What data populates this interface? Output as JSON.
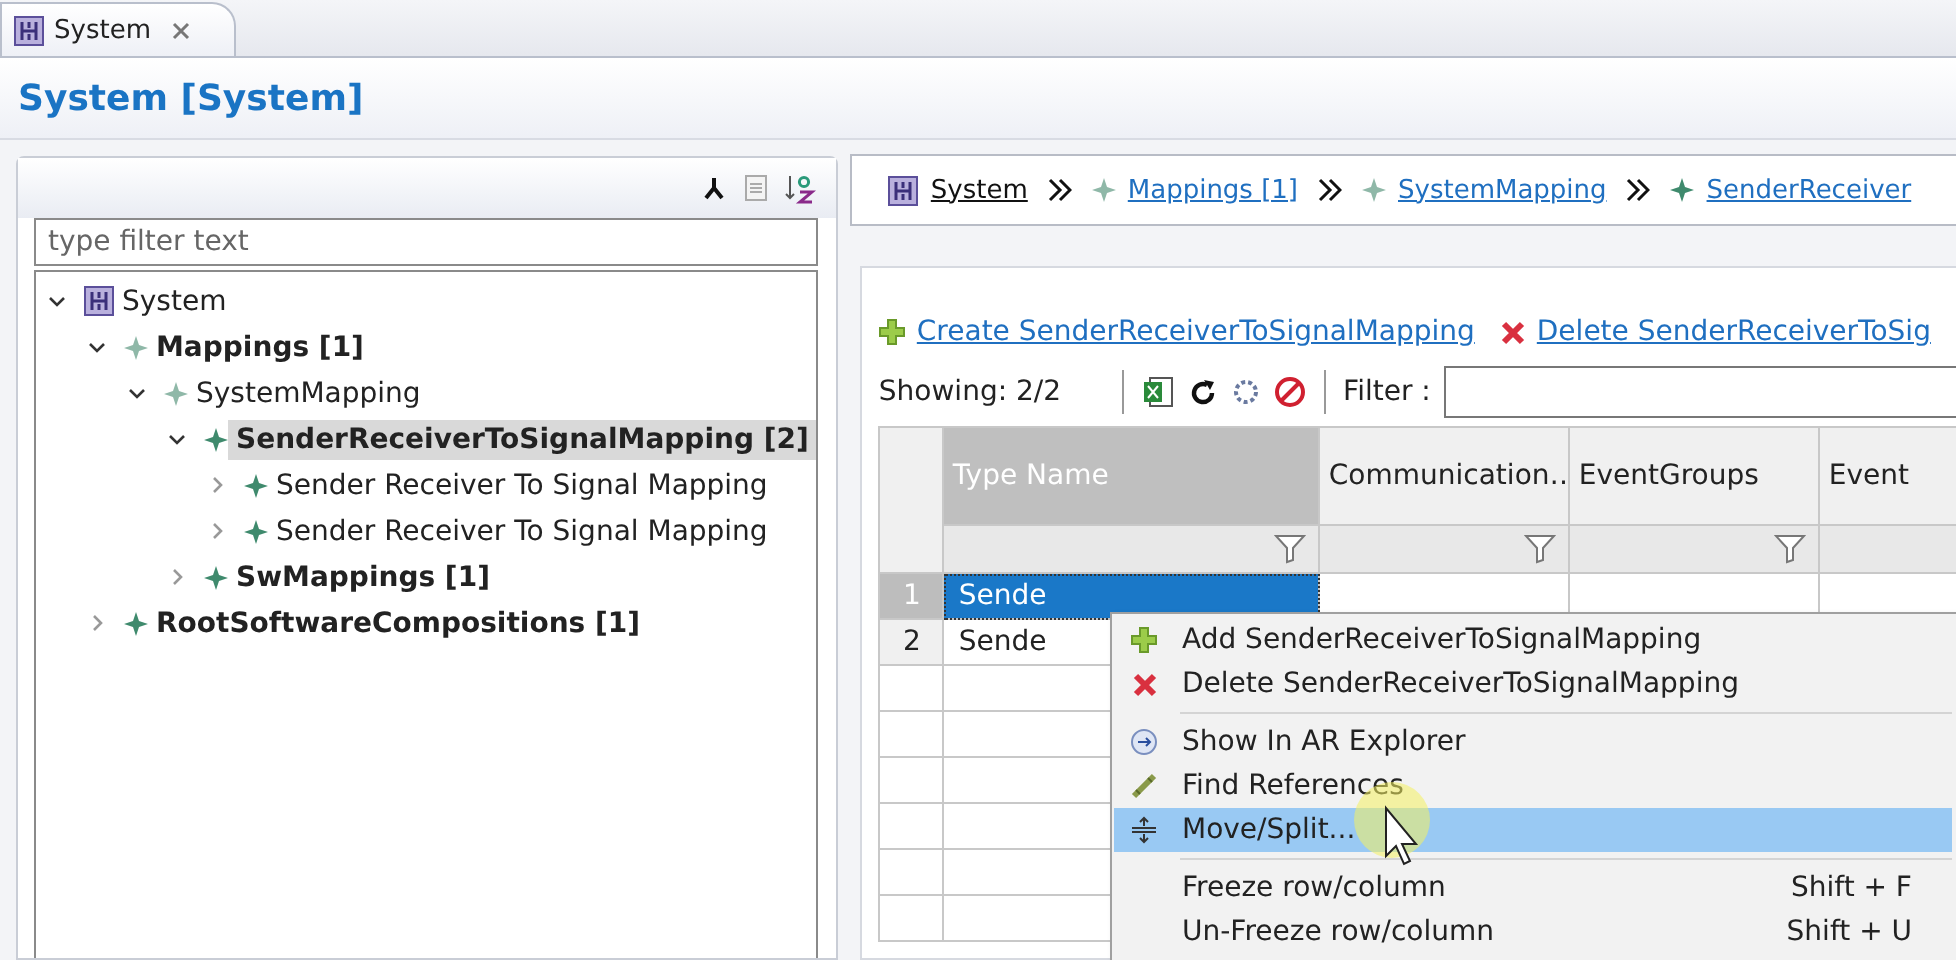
{
  "editor_tab": {
    "label": "System"
  },
  "page_title": "System [System]",
  "outline": {
    "filter": {
      "placeholder": "type filter text"
    },
    "tree": [
      {
        "label": "System",
        "kind": "system",
        "bold": false,
        "selected": false,
        "expanded": true,
        "children": [
          {
            "label": "Mappings [1]",
            "kind": "element",
            "bold": true,
            "selected": false,
            "expanded": true,
            "children": [
              {
                "label": "SystemMapping",
                "kind": "element",
                "bold": false,
                "selected": false,
                "expanded": true,
                "children": [
                  {
                    "label": "SenderReceiverToSignalMapping [2]",
                    "kind": "mapping",
                    "bold": true,
                    "selected": true,
                    "expanded": true,
                    "children": [
                      {
                        "label": "Sender Receiver To Signal Mapping",
                        "kind": "mapping",
                        "bold": false,
                        "selected": false,
                        "expanded": false
                      },
                      {
                        "label": "Sender Receiver To Signal Mapping",
                        "kind": "mapping",
                        "bold": false,
                        "selected": false,
                        "expanded": false
                      }
                    ]
                  },
                  {
                    "label": "SwMappings [1]",
                    "kind": "mapping",
                    "bold": true,
                    "selected": false,
                    "expanded": false
                  }
                ]
              }
            ]
          },
          {
            "label": "RootSoftwareCompositions [1]",
            "kind": "mapping",
            "bold": true,
            "selected": false,
            "expanded": false
          }
        ]
      }
    ]
  },
  "breadcrumb": [
    {
      "label": "System",
      "kind": "system"
    },
    {
      "label": "Mappings [1]",
      "kind": "element"
    },
    {
      "label": "SystemMapping",
      "kind": "element"
    },
    {
      "label": "SenderReceiver",
      "kind": "mapping"
    }
  ],
  "actions": [
    {
      "label": "Create SenderReceiverToSignalMapping",
      "kind": "create"
    },
    {
      "label": "Delete SenderReceiverToSig",
      "kind": "delete"
    }
  ],
  "table_toolbar": {
    "showing": "Showing: 2/2",
    "filter_label": "Filter :"
  },
  "table": {
    "columns": [
      {
        "label": "Type Name",
        "selected": true
      },
      {
        "label": "Communication…",
        "selected": false
      },
      {
        "label": "EventGroups",
        "selected": false
      },
      {
        "label": "Event",
        "selected": false
      }
    ],
    "rows": [
      {
        "number": "1",
        "cells": [
          "Sende"
        ],
        "selected": true
      },
      {
        "number": "2",
        "cells": [
          "Sende"
        ],
        "selected": false
      }
    ]
  },
  "context_menu": [
    {
      "kind": "add",
      "label": "Add SenderReceiverToSignalMapping",
      "highlighted": false
    },
    {
      "kind": "delete",
      "label": "Delete SenderReceiverToSignalMapping",
      "highlighted": false
    },
    {
      "kind": "separator"
    },
    {
      "kind": "show",
      "label": "Show In AR Explorer",
      "highlighted": false
    },
    {
      "kind": "find",
      "label": "Find References",
      "highlighted": false
    },
    {
      "kind": "move",
      "label": "Move/Split...",
      "highlighted": true
    },
    {
      "kind": "separator"
    },
    {
      "kind": "plain",
      "label": "Freeze row/column",
      "shortcut": "Shift + F",
      "highlighted": false
    },
    {
      "kind": "plain",
      "label": "Un-Freeze row/column",
      "shortcut": "Shift + U",
      "highlighted": false
    }
  ]
}
